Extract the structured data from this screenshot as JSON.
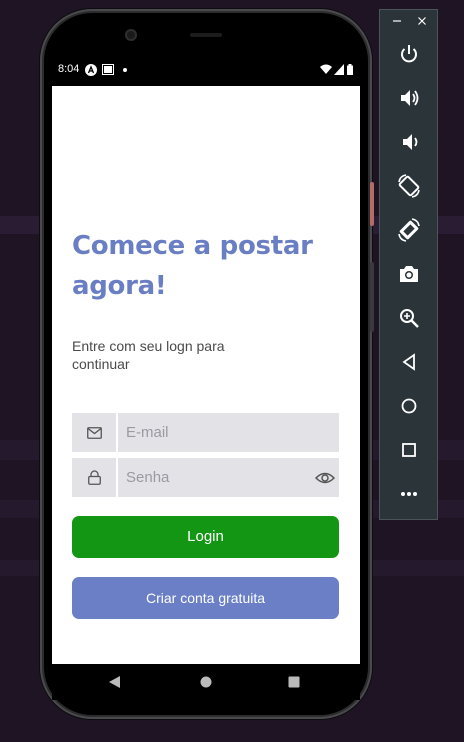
{
  "status_bar": {
    "time": "8:04"
  },
  "headline": "Comece a postar agora!",
  "subtext": "Entre com seu logn para continuar",
  "form": {
    "email_placeholder": "E-mail",
    "email_value": "",
    "password_placeholder": "Senha",
    "password_value": ""
  },
  "buttons": {
    "login_label": "Login",
    "create_label": "Criar conta gratuita"
  },
  "colors": {
    "accent": "#6a7fc3",
    "login": "#129613",
    "create": "#6a7fc6",
    "field_bg": "#e2e2e7"
  },
  "emulator_toolbar": {
    "window_controls": [
      "minimize-icon",
      "close-icon"
    ],
    "items": [
      "power-icon",
      "volume-up-icon",
      "volume-down-icon",
      "rotate-left-icon",
      "rotate-right-icon",
      "camera-icon",
      "zoom-icon",
      "back-icon",
      "home-icon",
      "overview-icon",
      "more-icon"
    ]
  }
}
